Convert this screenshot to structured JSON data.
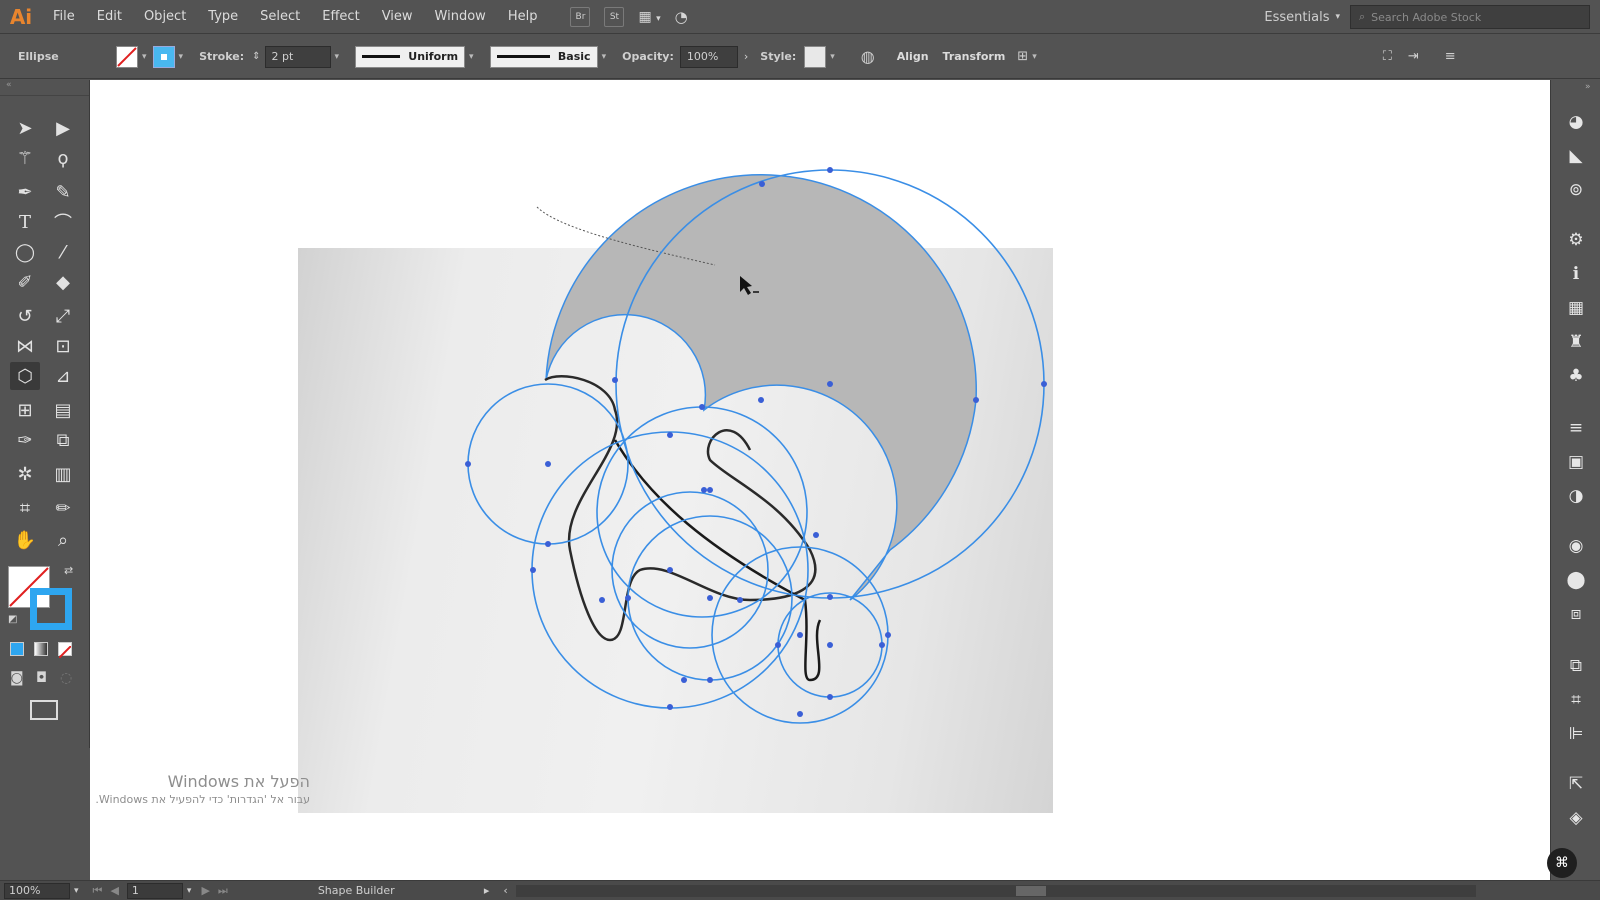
{
  "menubar": {
    "app_logo": "Ai",
    "items": [
      "File",
      "Edit",
      "Object",
      "Type",
      "Select",
      "Effect",
      "View",
      "Window",
      "Help"
    ],
    "bridge_icon": "Br",
    "stock_icon": "St",
    "workspace_label": "Essentials",
    "search_placeholder": "Search Adobe Stock"
  },
  "controlbar": {
    "selection_label": "Ellipse",
    "stroke_label": "Stroke:",
    "stroke_weight": "2 pt",
    "profile_uniform": "Uniform",
    "brush_basic": "Basic",
    "opacity_label": "Opacity:",
    "opacity_value": "100%",
    "style_label": "Style:",
    "align_label": "Align",
    "transform_label": "Transform"
  },
  "colors": {
    "app_bg": "#535353",
    "canvas_bg": "#ffffff",
    "selection_blue": "#3a8ee6",
    "shape_fill": "#b5b5b5",
    "logo_orange": "#e8852e"
  },
  "tools": {
    "active": "shape-builder-tool",
    "icons": [
      "selection-tool-icon",
      "direct-selection-tool-icon",
      "magic-wand-icon",
      "lasso-icon",
      "pen-tool-icon",
      "curvature-tool-icon",
      "type-tool-icon",
      "line-segment-icon",
      "ellipse-tool-icon",
      "paintbrush-icon",
      "shaper-tool-icon",
      "eraser-icon",
      "rotate-icon",
      "scale-icon",
      "width-tool-icon",
      "free-transform-icon",
      "shape-builder-icon",
      "perspective-grid-icon",
      "mesh-icon",
      "gradient-icon",
      "eyedropper-icon",
      "blend-icon",
      "symbol-sprayer-icon",
      "column-graph-icon",
      "artboard-icon",
      "slice-icon",
      "hand-icon",
      "zoom-icon"
    ]
  },
  "watermark": {
    "title": "הפעל את Windows",
    "subtitle": "עבור אל 'הגדרות' כדי להפעיל את Windows."
  },
  "statusbar": {
    "zoom": "100%",
    "artboard_number": "1",
    "current_tool": "Shape Builder"
  }
}
